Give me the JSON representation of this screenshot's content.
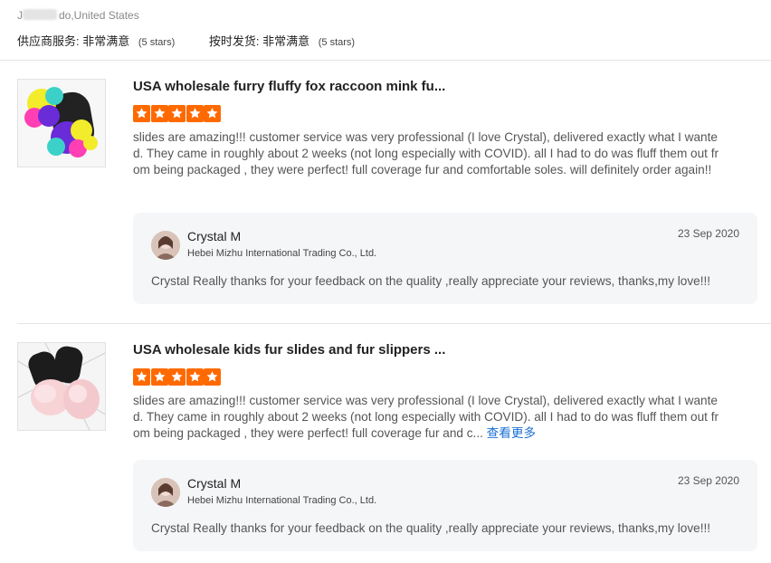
{
  "reviewer": {
    "name_masked": "J",
    "name_rest": "do,United States"
  },
  "ratings": {
    "supplier_service_label": "供应商服务:",
    "supplier_service_value": "非常满意",
    "supplier_service_stars": "(5 stars)",
    "ontime_label": "按时发货:",
    "ontime_value": "非常满意",
    "ontime_stars": "(5 stars)"
  },
  "colors": {
    "star": "#ff6a00",
    "link": "#1a6fd6",
    "reply_bg": "#f5f6f8"
  },
  "reviews": [
    {
      "title": "USA wholesale furry fluffy fox raccoon mink fu...",
      "rating": 5,
      "text": "slides are amazing!!! customer service was very professional (I love Crystal), delivered exactly what I wanted. They came in roughly about 2 weeks (not long especially with COVID). all I had to do was fluff them out from being packaged , they were perfect! full coverage fur and comfortable soles. will definitely order again!!",
      "see_more": "",
      "reply": {
        "name": "Crystal M",
        "company": "Hebei Mizhu International Trading Co., Ltd.",
        "date": "23 Sep 2020",
        "message": "Crystal Really thanks for your feedback on the quality ,really appreciate your reviews, thanks,my love!!!"
      }
    },
    {
      "title": "USA wholesale kids fur slides and fur slippers ...",
      "rating": 5,
      "text": "slides are amazing!!! customer service was very professional (I love Crystal), delivered exactly what I wanted. They came in roughly about 2 weeks (not long especially with COVID). all I had to do was fluff them out from being packaged , they were perfect! full coverage fur and c...",
      "see_more": "查看更多",
      "reply": {
        "name": "Crystal M",
        "company": "Hebei Mizhu International Trading Co., Ltd.",
        "date": "23 Sep 2020",
        "message": "Crystal Really thanks for your feedback on the quality ,really appreciate your reviews, thanks,my love!!!"
      }
    }
  ]
}
